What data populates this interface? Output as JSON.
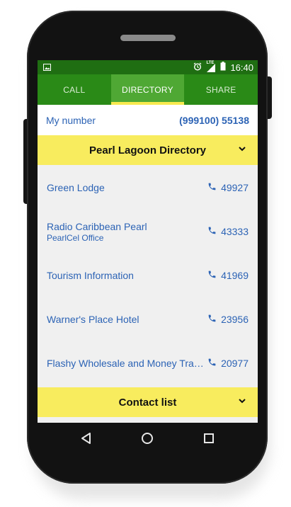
{
  "status_bar": {
    "time": "16:40",
    "lte": "LTE",
    "icons": [
      "screenshot-icon",
      "alarm-icon",
      "signal-icon",
      "battery-icon"
    ]
  },
  "tabs": [
    {
      "label": "CALL",
      "active": false
    },
    {
      "label": "DIRECTORY",
      "active": true
    },
    {
      "label": "SHARE",
      "active": false
    }
  ],
  "my_number": {
    "label": "My number",
    "value": "(999100) 55138"
  },
  "directory": {
    "title": "Pearl Lagoon Directory",
    "entries": [
      {
        "name": "Green Lodge",
        "subtitle": "",
        "number": "49927"
      },
      {
        "name": "Radio Caribbean Pearl",
        "subtitle": "PearlCel Office",
        "number": "43333"
      },
      {
        "name": "Tourism Information",
        "subtitle": "",
        "number": "41969"
      },
      {
        "name": "Warner's Place Hotel",
        "subtitle": "",
        "number": "23956"
      },
      {
        "name": "Flashy Wholesale and Money Trans...",
        "subtitle": "",
        "number": "20977"
      }
    ]
  },
  "contact_list": {
    "title": "Contact list"
  },
  "colors": {
    "status_bar": "#1f6e12",
    "tab_bar": "#2a8a17",
    "tab_active": "#4fa834",
    "accent_yellow": "#f8ec5e",
    "link_blue": "#2c63b5"
  },
  "navigation": [
    "back-icon",
    "home-icon",
    "recents-icon"
  ]
}
